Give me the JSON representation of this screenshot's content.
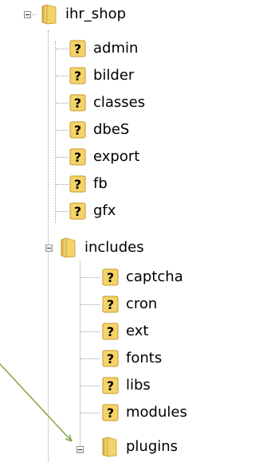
{
  "tree": {
    "root": {
      "label": "ihr_shop",
      "icon": "folder-icon"
    },
    "children": [
      {
        "label": "admin",
        "icon": "unknown-folder-icon"
      },
      {
        "label": "bilder",
        "icon": "unknown-folder-icon"
      },
      {
        "label": "classes",
        "icon": "unknown-folder-icon"
      },
      {
        "label": "dbeS",
        "icon": "unknown-folder-icon"
      },
      {
        "label": "export",
        "icon": "unknown-folder-icon"
      },
      {
        "label": "fb",
        "icon": "unknown-folder-icon"
      },
      {
        "label": "gfx",
        "icon": "unknown-folder-icon"
      },
      {
        "label": "includes",
        "icon": "folder-icon",
        "children": [
          {
            "label": "captcha",
            "icon": "unknown-folder-icon"
          },
          {
            "label": "cron",
            "icon": "unknown-folder-icon"
          },
          {
            "label": "ext",
            "icon": "unknown-folder-icon"
          },
          {
            "label": "fonts",
            "icon": "unknown-folder-icon"
          },
          {
            "label": "libs",
            "icon": "unknown-folder-icon"
          },
          {
            "label": "modules",
            "icon": "unknown-folder-icon"
          },
          {
            "label": "plugins",
            "icon": "folder-icon"
          }
        ]
      }
    ]
  },
  "colors": {
    "folder": "#f4d46a",
    "unknown_question": "#000000",
    "arrow": "#86a94b",
    "guide": "#a3a3a3"
  }
}
